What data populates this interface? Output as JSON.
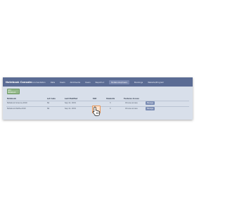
{
  "navbar": {
    "brand": "Notebook Console",
    "items": [
      "Documentation",
      "Data",
      "Users",
      "Allotments",
      "Users",
      "Reports ▾",
      "Notebooks/Users",
      "Bookings",
      "Website/Program"
    ],
    "active_index": 6
  },
  "toolbar": {
    "add_label": "Add Notebook"
  },
  "table": {
    "headers": [
      "Notebook",
      "Lot Code",
      "Last Modified",
      "Edit",
      "Students",
      "Features Access"
    ],
    "rows": [
      {
        "notebook": "Notebook-Science-2019",
        "code": "N1",
        "date": "Sep 12, 2019",
        "count": "3",
        "access": "Choose access",
        "action": "Manage"
      },
      {
        "notebook": "Notebook-Maths-2019",
        "code": "N2",
        "date": "Sep 12, 2019",
        "count": "4",
        "access": "Choose access",
        "action": "Manage"
      }
    ]
  },
  "colors": {
    "navbar": "#5b6c94",
    "panel": "#d8dfea",
    "add_button": "#94b98a",
    "action_button": "#7a8cb3",
    "edit_highlight": "#e89558"
  },
  "icons": [
    "pointer-cursor-icon",
    "edit-icon"
  ]
}
